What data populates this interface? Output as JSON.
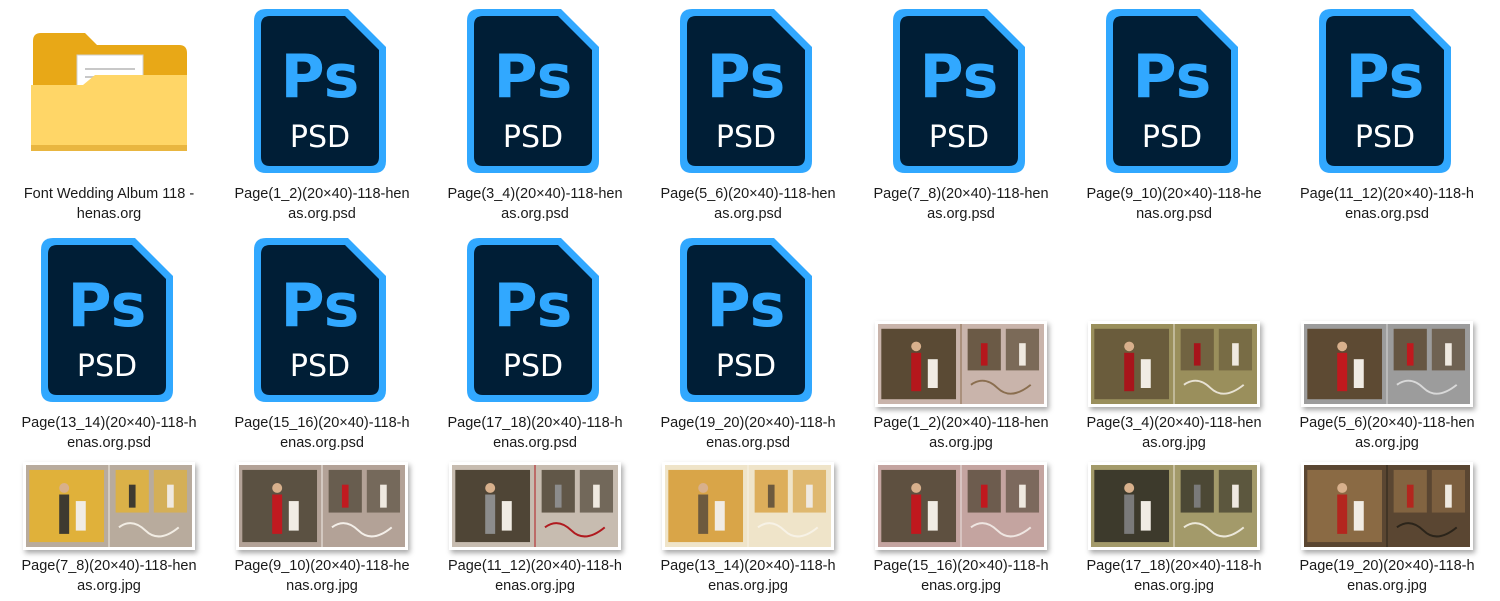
{
  "window": {
    "view": "Large icons"
  },
  "colors": {
    "ps_background": "#001e36",
    "ps_accent": "#31a8ff",
    "folder_back": "#e8a817",
    "folder_front": "#ffd667"
  },
  "items": [
    {
      "name": "Font Wedding Album 118 - henas.org",
      "label_line1": "Font Wedding Album 118 -",
      "label_line2": "henas.org",
      "type": "folder",
      "icon": "folder-icon"
    },
    {
      "name": "Page(1_2)(20×40)-118-henas.org.psd",
      "label_line1": "Page(1_2)(20×40)-118-hen",
      "label_line2": "as.org.psd",
      "type": "psd",
      "icon": "psd-icon",
      "icon_text_top": "Ps",
      "icon_text_bottom": "PSD"
    },
    {
      "name": "Page(3_4)(20×40)-118-henas.org.psd",
      "label_line1": "Page(3_4)(20×40)-118-hen",
      "label_line2": "as.org.psd",
      "type": "psd",
      "icon": "psd-icon",
      "icon_text_top": "Ps",
      "icon_text_bottom": "PSD"
    },
    {
      "name": "Page(5_6)(20×40)-118-henas.org.psd",
      "label_line1": "Page(5_6)(20×40)-118-hen",
      "label_line2": "as.org.psd",
      "type": "psd",
      "icon": "psd-icon",
      "icon_text_top": "Ps",
      "icon_text_bottom": "PSD"
    },
    {
      "name": "Page(7_8)(20×40)-118-henas.org.psd",
      "label_line1": "Page(7_8)(20×40)-118-hen",
      "label_line2": "as.org.psd",
      "type": "psd",
      "icon": "psd-icon",
      "icon_text_top": "Ps",
      "icon_text_bottom": "PSD"
    },
    {
      "name": "Page(9_10)(20×40)-118-henas.org.psd",
      "label_line1": "Page(9_10)(20×40)-118-he",
      "label_line2": "nas.org.psd",
      "type": "psd",
      "icon": "psd-icon",
      "icon_text_top": "Ps",
      "icon_text_bottom": "PSD"
    },
    {
      "name": "Page(11_12)(20×40)-118-henas.org.psd",
      "label_line1": "Page(11_12)(20×40)-118-h",
      "label_line2": "enas.org.psd",
      "type": "psd",
      "icon": "psd-icon",
      "icon_text_top": "Ps",
      "icon_text_bottom": "PSD"
    },
    {
      "name": "Page(13_14)(20×40)-118-henas.org.psd",
      "label_line1": "Page(13_14)(20×40)-118-h",
      "label_line2": "enas.org.psd",
      "type": "psd",
      "icon": "psd-icon",
      "icon_text_top": "Ps",
      "icon_text_bottom": "PSD"
    },
    {
      "name": "Page(15_16)(20×40)-118-henas.org.psd",
      "label_line1": "Page(15_16)(20×40)-118-h",
      "label_line2": "enas.org.psd",
      "type": "psd",
      "icon": "psd-icon",
      "icon_text_top": "Ps",
      "icon_text_bottom": "PSD"
    },
    {
      "name": "Page(17_18)(20×40)-118-henas.org.psd",
      "label_line1": "Page(17_18)(20×40)-118-h",
      "label_line2": "enas.org.psd",
      "type": "psd",
      "icon": "psd-icon",
      "icon_text_top": "Ps",
      "icon_text_bottom": "PSD"
    },
    {
      "name": "Page(19_20)(20×40)-118-henas.org.psd",
      "label_line1": "Page(19_20)(20×40)-118-h",
      "label_line2": "enas.org.psd",
      "type": "psd",
      "icon": "psd-icon",
      "icon_text_top": "Ps",
      "icon_text_bottom": "PSD"
    },
    {
      "name": "Page(1_2)(20×40)-118-henas.org.jpg",
      "label_line1": "Page(1_2)(20×40)-118-hen",
      "label_line2": "as.org.jpg",
      "type": "jpg",
      "icon": "image-thumbnail",
      "palette": [
        "#c9b4ab",
        "#5a4a34",
        "#b5171c",
        "#8a6e4f"
      ]
    },
    {
      "name": "Page(3_4)(20×40)-118-henas.org.jpg",
      "label_line1": "Page(3_4)(20×40)-118-hen",
      "label_line2": "as.org.jpg",
      "type": "jpg",
      "icon": "image-thumbnail",
      "palette": [
        "#9a8f5c",
        "#6a5c3c",
        "#a8141b",
        "#e8e2d4"
      ]
    },
    {
      "name": "Page(5_6)(20×40)-118-henas.org.jpg",
      "label_line1": "Page(5_6)(20×40)-118-hen",
      "label_line2": "as.org.jpg",
      "type": "jpg",
      "icon": "image-thumbnail",
      "palette": [
        "#9c9c9c",
        "#5d4a33",
        "#c0191e",
        "#d9d9d9"
      ]
    },
    {
      "name": "Page(7_8)(20×40)-118-henas.org.jpg",
      "label_line1": "Page(7_8)(20×40)-118-hen",
      "label_line2": "as.org.jpg",
      "type": "jpg",
      "icon": "image-thumbnail",
      "palette": [
        "#b8ab9d",
        "#e0b13a",
        "#3e3a30",
        "#f2ede4"
      ]
    },
    {
      "name": "Page(9_10)(20×40)-118-henas.org.jpg",
      "label_line1": "Page(9_10)(20×40)-118-he",
      "label_line2": "nas.org.jpg",
      "type": "jpg",
      "icon": "image-thumbnail",
      "palette": [
        "#b3a297",
        "#5b5142",
        "#c01a20",
        "#f4efe9"
      ]
    },
    {
      "name": "Page(11_12)(20×40)-118-henas.org.jpg",
      "label_line1": "Page(11_12)(20×40)-118-h",
      "label_line2": "enas.org.jpg",
      "type": "jpg",
      "icon": "image-thumbnail",
      "palette": [
        "#c7bcb0",
        "#4f4536",
        "#8c8c8c",
        "#b01a1f"
      ]
    },
    {
      "name": "Page(13_14)(20×40)-118-henas.org.jpg",
      "label_line1": "Page(13_14)(20×40)-118-h",
      "label_line2": "enas.org.jpg",
      "type": "jpg",
      "icon": "image-thumbnail",
      "palette": [
        "#efe4c9",
        "#d9a548",
        "#6d5a3e",
        "#f7f2e6"
      ]
    },
    {
      "name": "Page(15_16)(20×40)-118-henas.org.jpg",
      "label_line1": "Page(15_16)(20×40)-118-h",
      "label_line2": "enas.org.jpg",
      "type": "jpg",
      "icon": "image-thumbnail",
      "palette": [
        "#c4a4a0",
        "#5e5040",
        "#c0181e",
        "#efe6e2"
      ]
    },
    {
      "name": "Page(17_18)(20×40)-118-henas.org.jpg",
      "label_line1": "Page(17_18)(20×40)-118-h",
      "label_line2": "enas.org.jpg",
      "type": "jpg",
      "icon": "image-thumbnail",
      "palette": [
        "#a39a6a",
        "#3d3a2c",
        "#7a7a7a",
        "#ece8da"
      ]
    },
    {
      "name": "Page(19_20)(20×40)-118-henas.org.jpg",
      "label_line1": "Page(19_20)(20×40)-118-h",
      "label_line2": "enas.org.jpg",
      "type": "jpg",
      "icon": "image-thumbnail",
      "palette": [
        "#5a4632",
        "#8a6a44",
        "#b3261e",
        "#2b241a"
      ]
    }
  ]
}
